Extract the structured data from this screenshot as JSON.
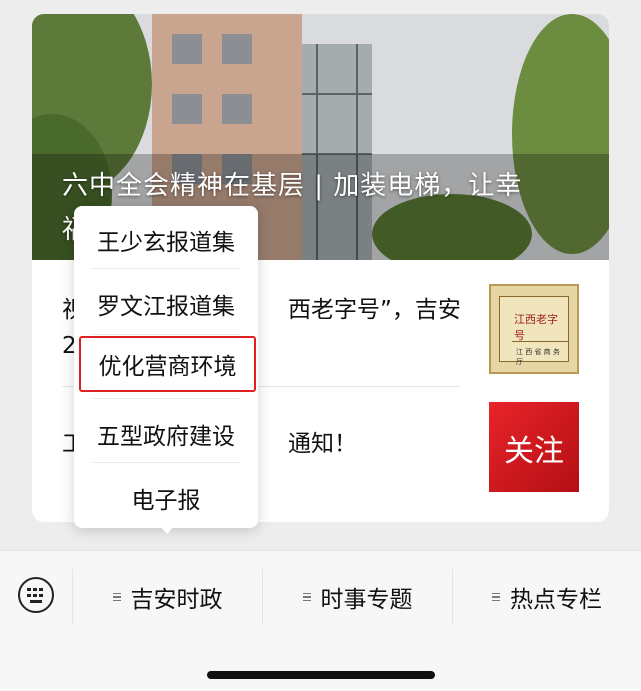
{
  "hero": {
    "title": "六中全会精神在基层 | 加装电梯，让幸",
    "title_line2": "福"
  },
  "articles": [
    {
      "line1": "视",
      "line1_tail": "西老字号”，吉安",
      "line2": "2"
    },
    {
      "line1": "工",
      "line1_tail": "通知！"
    }
  ],
  "thumbnails": {
    "plaque_text": "江西老字号",
    "plaque_sub": "江 西 省 商 务 厅",
    "follow_label": "关注"
  },
  "popup_menu": {
    "items": [
      {
        "label": "王少玄报道集"
      },
      {
        "label": "罗文江报道集"
      },
      {
        "label": "优化营商环境"
      },
      {
        "label": "五型政府建设"
      },
      {
        "label": "电子报"
      }
    ],
    "highlighted_index": 2,
    "highlight_color": "#e02020"
  },
  "bottom_bar": {
    "keyboard_icon": "keyboard-icon",
    "tabs": [
      {
        "label": "吉安时政"
      },
      {
        "label": "时事专题"
      },
      {
        "label": "热点专栏"
      }
    ]
  },
  "colors": {
    "background": "#ededed",
    "card": "#ffffff",
    "follow_red": "#e8242a"
  }
}
